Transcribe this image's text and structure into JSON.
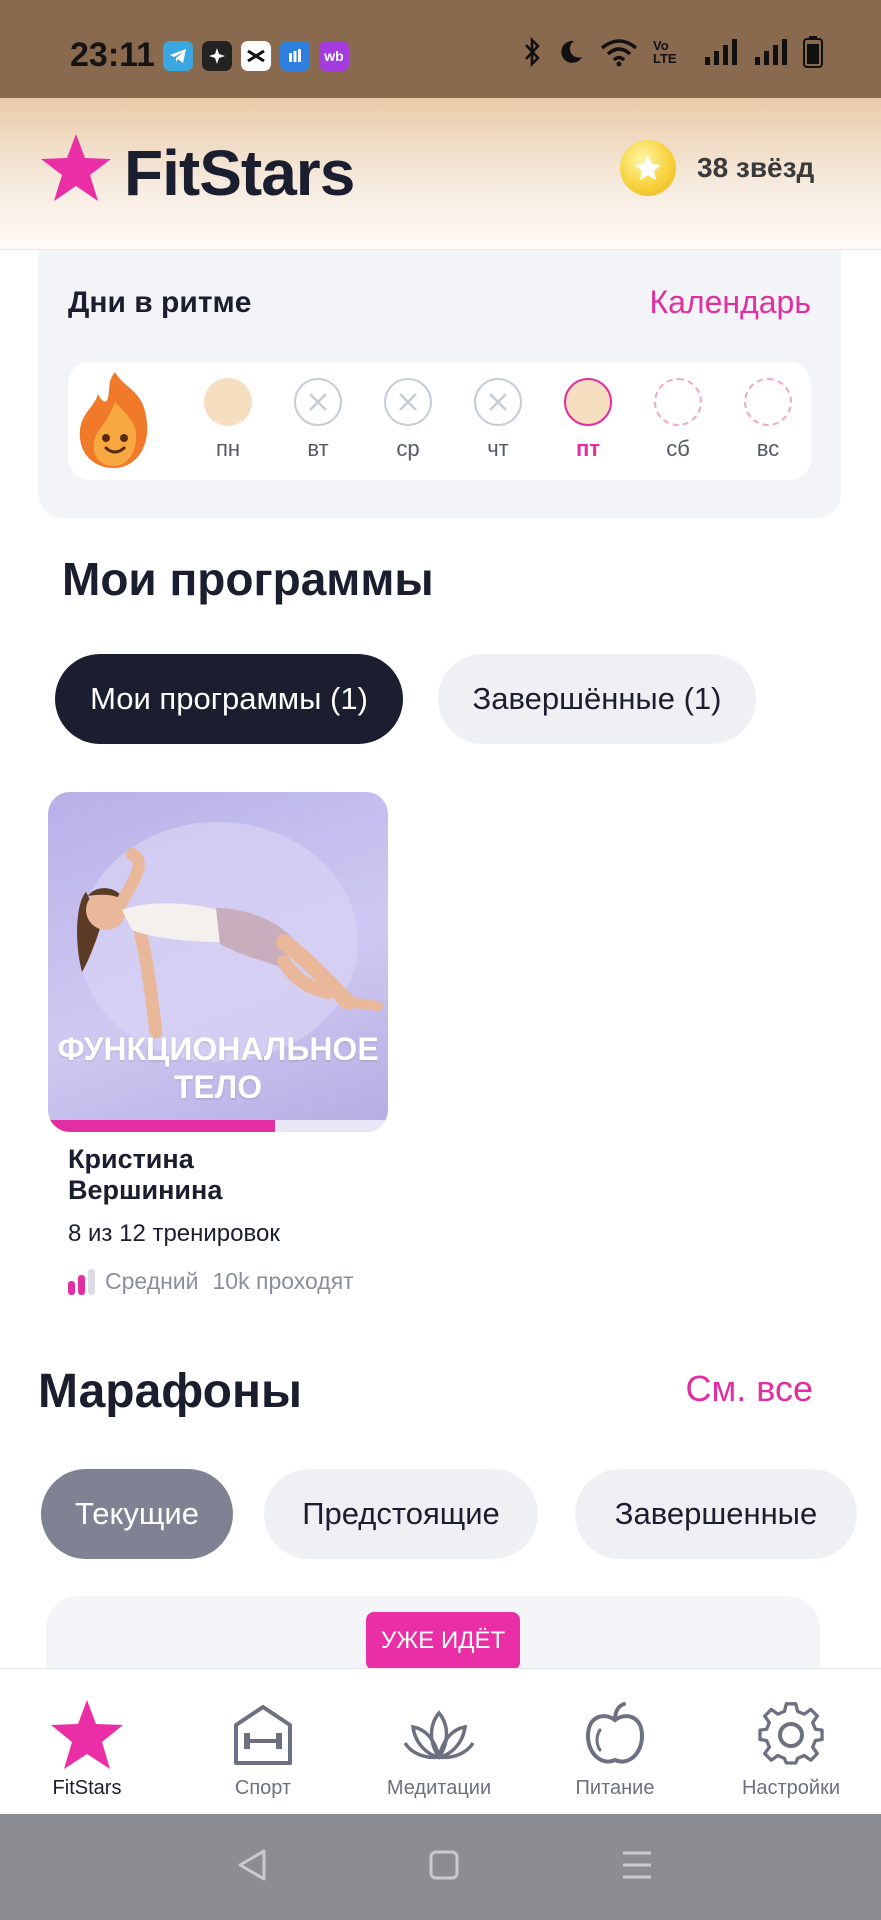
{
  "status_bar": {
    "time": "23:11",
    "apps": [
      "telegram-icon",
      "ai-star-icon",
      "capcut-icon",
      "mobile-bank-icon",
      "wb"
    ],
    "network": "Vo LTE"
  },
  "header": {
    "logo_text": "FitStars",
    "stars_label": "38 звёзд",
    "accent": "#e22ea0"
  },
  "rhythm": {
    "title": "Дни в ритме",
    "calendar_link": "Календарь",
    "days": [
      {
        "label": "пн",
        "state": "done"
      },
      {
        "label": "вт",
        "state": "missed"
      },
      {
        "label": "ср",
        "state": "missed"
      },
      {
        "label": "чт",
        "state": "missed"
      },
      {
        "label": "пт",
        "state": "today"
      },
      {
        "label": "сб",
        "state": "future"
      },
      {
        "label": "вс",
        "state": "future"
      }
    ]
  },
  "programs": {
    "heading": "Мои программы",
    "tabs": [
      {
        "label": "Мои программы (1)",
        "active": true
      },
      {
        "label": "Завершённые (1)",
        "active": false
      }
    ],
    "card": {
      "title_line1": "ФУНКЦИОНАЛЬНОЕ",
      "title_line2": "ТЕЛО",
      "author": "Кристина Вершинина",
      "workouts": "8 из 12 тренировок",
      "progress": 0.667,
      "level": "Средний",
      "participants": "10k проходят"
    }
  },
  "marathons": {
    "heading": "Марафоны",
    "see_all": "См. все",
    "tabs": [
      {
        "label": "Текущие",
        "active": true
      },
      {
        "label": "Предстоящие",
        "active": false
      },
      {
        "label": "Завершенные",
        "active": false
      }
    ],
    "badge": "УЖЕ ИДЁТ"
  },
  "bottom_nav": [
    {
      "label": "FitStars",
      "icon": "star-icon",
      "active": true
    },
    {
      "label": "Спорт",
      "icon": "gym-icon",
      "active": false
    },
    {
      "label": "Медитации",
      "icon": "lotus-icon",
      "active": false
    },
    {
      "label": "Питание",
      "icon": "apple-icon",
      "active": false
    },
    {
      "label": "Настройки",
      "icon": "gear-icon",
      "active": false
    }
  ]
}
